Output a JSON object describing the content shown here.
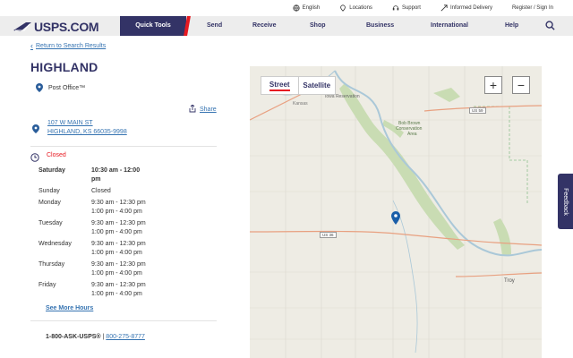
{
  "utility": {
    "english": "English",
    "locations": "Locations",
    "support": "Support",
    "informed_delivery": "Informed Delivery",
    "register": "Register / Sign In"
  },
  "brand": {
    "name": "USPS.COM"
  },
  "nav": {
    "items": [
      "Quick Tools",
      "Send",
      "Receive",
      "Shop",
      "Business",
      "International",
      "Help"
    ]
  },
  "back_link": "Return to Search Results",
  "location": {
    "name": "HIGHLAND",
    "type": "Post Office™",
    "share": "Share",
    "address_line1": "107 W MAIN ST",
    "address_line2": "HIGHLAND, KS 66035-9998",
    "status": "Closed"
  },
  "hours": [
    {
      "day": "Saturday",
      "line1": "10:30 am - 12:00",
      "line2": "pm"
    },
    {
      "day": "Sunday",
      "line1": "Closed",
      "line2": ""
    },
    {
      "day": "Monday",
      "line1": "9:30 am - 12:30 pm",
      "line2": "1:00 pm - 4:00 pm"
    },
    {
      "day": "Tuesday",
      "line1": "9:30 am - 12:30 pm",
      "line2": "1:00 pm - 4:00 pm"
    },
    {
      "day": "Wednesday",
      "line1": "9:30 am - 12:30 pm",
      "line2": "1:00 pm - 4:00 pm"
    },
    {
      "day": "Thursday",
      "line1": "9:30 am - 12:30 pm",
      "line2": "1:00 pm - 4:00 pm"
    },
    {
      "day": "Friday",
      "line1": "9:30 am - 12:30 pm",
      "line2": "1:00 pm - 4:00 pm"
    }
  ],
  "more_hours": "See More Hours",
  "contact": {
    "label": "1-800-ASK-USPS®",
    "sep": " | ",
    "number": "800-275-8777"
  },
  "map": {
    "street": "Street",
    "satellite": "Satellite",
    "zoom_in": "+",
    "zoom_out": "−",
    "labels": {
      "iowa": "Iowa Reservation",
      "kansas": "Kansas",
      "bobbrown": "Bob Brown",
      "conservation": "Conservation",
      "area": "Area",
      "troy": "Troy"
    },
    "shields": {
      "us36": "US 36",
      "us59": "US 59"
    },
    "colors": {
      "river": "#aac8d8",
      "highway": "#e8a080",
      "forest": "#c9dcb3"
    }
  },
  "feedback": "Feedback",
  "colors": {
    "navy": "#333366",
    "red": "#e71921",
    "link": "#3573b1"
  }
}
